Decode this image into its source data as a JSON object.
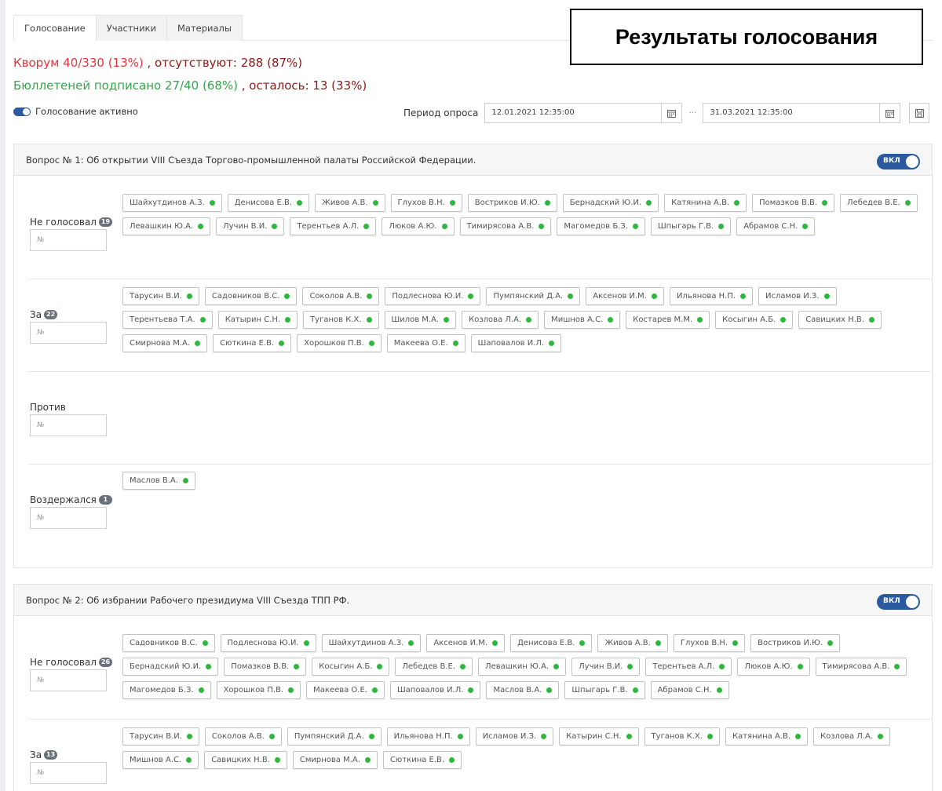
{
  "tabs": [
    {
      "label": "Голосование"
    },
    {
      "label": "Участники"
    },
    {
      "label": "Материалы"
    }
  ],
  "overlay_title": "Результаты голосования",
  "stats": {
    "quorum": "Кворум 40/330 (13%)",
    "absent": ", отсутствуют: 288 (87%)",
    "signed": "Бюллетеней подписано 27/40 (68%)",
    "remaining": ", осталось: 13 (33%)"
  },
  "voting_active_label": "Голосование активно",
  "period": {
    "label": "Период опроса",
    "start": "12.01.2021 12:35:00",
    "separator": "···",
    "end": "31.03.2021 12:35:00"
  },
  "colors": {
    "accent": "#2c5aa0",
    "online_dot": "#2db83d",
    "quorum_red": "#e8333d",
    "signed_green": "#2fa84a"
  },
  "input_placeholder": "№",
  "switch_label": "ВКЛ",
  "questions": [
    {
      "title": "Вопрос № 1: Об открытии VIII Съезда Торгово-промышленной палаты Российской Федерации.",
      "groups": [
        {
          "label": "Не голосовал",
          "count": "19",
          "members": [
            "Шайхутдинов А.З.",
            "Денисова Е.В.",
            "Живов А.В.",
            "Глухов В.Н.",
            "Востриков И.Ю.",
            "Бернадский Ю.И.",
            "Катянина А.В.",
            "Помазков В.В.",
            "Лебедев В.Е.",
            "Левашкин Ю.А.",
            "Лучин В.И.",
            "Терентьев А.Л.",
            "Люков А.Ю.",
            "Тимирясова А.В.",
            "Магомедов Б.З.",
            "Шпыгарь Г.В.",
            "Абрамов С.Н."
          ]
        },
        {
          "label": "За",
          "count": "22",
          "members": [
            "Тарусин В.И.",
            "Садовников В.С.",
            "Соколов А.В.",
            "Подлеснова Ю.И.",
            "Пумпянский Д.А.",
            "Аксенов И.М.",
            "Ильянова Н.П.",
            "Исламов И.З.",
            "Терентьева Т.А.",
            "Катырин С.Н.",
            "Туганов К.Х.",
            "Шилов М.А.",
            "Козлова Л.А.",
            "Мишнов А.С.",
            "Костарев М.М.",
            "Косыгин А.Б.",
            "Савицких Н.В.",
            "Смирнова М.А.",
            "Сюткина Е.В.",
            "Хорошков П.В.",
            "Макеева О.Е.",
            "Шаповалов И.Л."
          ]
        },
        {
          "label": "Против",
          "count": "",
          "members": []
        },
        {
          "label": "Воздержался",
          "count": "1",
          "members": [
            "Маслов В.А."
          ]
        }
      ]
    },
    {
      "title": "Вопрос № 2: Об избрании Рабочего президиума VIII Съезда ТПП РФ.",
      "groups": [
        {
          "label": "Не голосовал",
          "count": "26",
          "members": [
            "Садовников В.С.",
            "Подлеснова Ю.И.",
            "Шайхутдинов А.З.",
            "Аксенов И.М.",
            "Денисова Е.В.",
            "Живов А.В.",
            "Глухов В.Н.",
            "Востриков И.Ю.",
            "Бернадский Ю.И.",
            "Помазков В.В.",
            "Косыгин А.Б.",
            "Лебедев В.Е.",
            "Левашкин Ю.А.",
            "Лучин В.И.",
            "Терентьев А.Л.",
            "Люков А.Ю.",
            "Тимирясова А.В.",
            "Магомедов Б.З.",
            "Хорошков П.В.",
            "Макеева О.Е.",
            "Шаповалов И.Л.",
            "Маслов В.А.",
            "Шпыгарь Г.В.",
            "Абрамов С.Н."
          ]
        },
        {
          "label": "За",
          "count": "13",
          "members": [
            "Тарусин В.И.",
            "Соколов А.В.",
            "Пумпянский Д.А.",
            "Ильянова Н.П.",
            "Исламов И.З.",
            "Катырин С.Н.",
            "Туганов К.Х.",
            "Катянина А.В.",
            "Козлова Л.А.",
            "Мишнов А.С.",
            "Савицких Н.В.",
            "Смирнова М.А.",
            "Сюткина Е.В."
          ]
        }
      ]
    }
  ]
}
